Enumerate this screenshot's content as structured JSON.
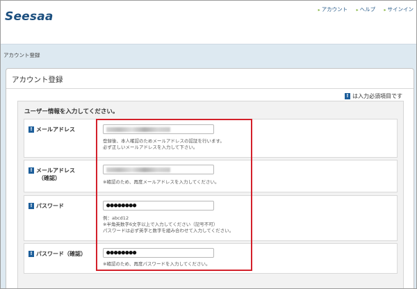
{
  "header": {
    "logo": "Seesaa",
    "nav": [
      {
        "label": "アカウント"
      },
      {
        "label": "ヘルプ"
      },
      {
        "label": "サインイン"
      }
    ]
  },
  "breadcrumb": "アカウント登録",
  "panel": {
    "title": "アカウント登録",
    "required_badge": "!",
    "required_note": "は入力必須項目です"
  },
  "form": {
    "section_title": "ユーザー情報を入力してください。",
    "fields": [
      {
        "label": "メールアドレス",
        "label_sub": "",
        "value": "",
        "help": [
          "登録後、本人確認のためメールアドレスの認証を行います。",
          "必ず正しいメールアドレスを入力して下さい。"
        ]
      },
      {
        "label": "メールアドレス",
        "label_sub": "（確認）",
        "value": "",
        "help": [
          "※確認のため、再度メールアドレスを入力してください。"
        ]
      },
      {
        "label": "パスワード",
        "label_sub": "",
        "value": "●●●●●●●●",
        "help": [
          "例：abcd12",
          "※半角英数字6文字以上で入力してください（記号不可）",
          "パスワードは必ず英字と数字を組み合わせて入力してください。"
        ]
      },
      {
        "label": "パスワード（確認）",
        "label_sub": "",
        "value": "●●●●●●●●",
        "help": [
          "※確認のため、再度パスワードを入力してください。"
        ]
      }
    ]
  },
  "colors": {
    "accent": "#1e5f9b",
    "highlight": "#d3202a",
    "band": "#dde9f1"
  }
}
